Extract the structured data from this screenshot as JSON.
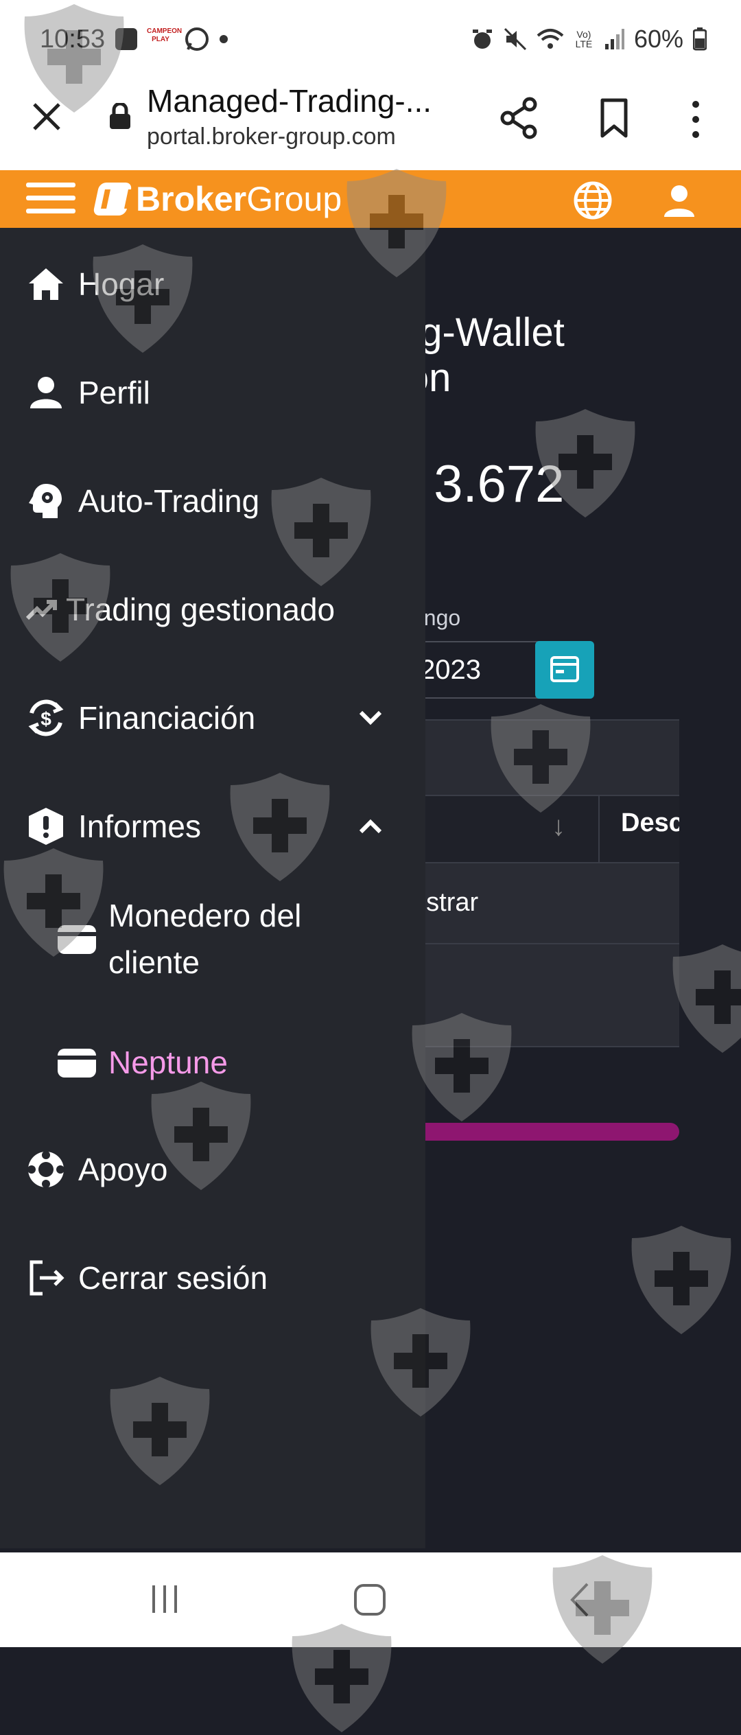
{
  "status_bar": {
    "time": "10:53",
    "left_icons": [
      "gallery-icon",
      "campeon-play-icon",
      "whatsapp-icon",
      "notification-dot-icon"
    ],
    "campeon_text": "CAMPEON PLAY",
    "right_icons": [
      "alarm-icon",
      "mute-icon",
      "wifi-icon",
      "volte-icon",
      "signal-icon",
      "battery-icon"
    ],
    "volte_text": "Vo) LTE",
    "battery": "60%"
  },
  "browser": {
    "title": "Managed-Trading-...",
    "url": "portal.broker-group.com"
  },
  "header": {
    "brand_bold": "Broker",
    "brand_regular": "Group",
    "accent": "#f6921e"
  },
  "background_page": {
    "title_line1": "ng-Wallet",
    "title_line2": "ión",
    "balance": ": 3.672",
    "range_label": "ango",
    "date_value": "2023",
    "column_desc": "Desc",
    "sort_arrow": "↓",
    "show_text": "ostrar",
    "progress_value": 1.0
  },
  "menu": {
    "items": [
      {
        "label": "Hogar",
        "icon": "home-icon"
      },
      {
        "label": "Perfil",
        "icon": "person-icon"
      },
      {
        "label": "Auto-Trading",
        "icon": "robot-head-icon"
      },
      {
        "label": "Trading gestionado",
        "icon": "trending-up-icon"
      },
      {
        "label": "Financiación",
        "icon": "finance-cycle-icon",
        "chevron": "down"
      },
      {
        "label": "Informes",
        "icon": "alert-icon",
        "chevron": "up"
      },
      {
        "label": "Apoyo",
        "icon": "lifebuoy-icon"
      },
      {
        "label": "Cerrar sesión",
        "icon": "logout-icon"
      }
    ],
    "sub_items": [
      {
        "label": "Monedero del cliente",
        "icon": "wallet-icon"
      },
      {
        "label": "Neptune",
        "icon": "wallet-icon",
        "active": true
      }
    ],
    "active_color": "#f59ae8"
  },
  "navbar": {
    "icons": [
      "recent-apps-icon",
      "home-button-icon",
      "back-icon"
    ]
  }
}
